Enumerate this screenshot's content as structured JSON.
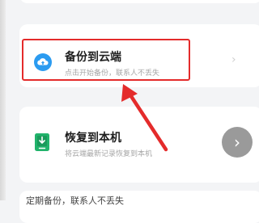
{
  "backup": {
    "title": "备份到云端",
    "subtitle": "点击开始备份，联系人不丢失",
    "icon": "cloud-upload-icon"
  },
  "restore": {
    "title": "恢复到本机",
    "subtitle": "将云端最新记录恢复到本机",
    "icon": "download-to-phone-icon"
  },
  "bottom": {
    "text": "定期备份，联系人不丢失"
  },
  "colors": {
    "accent_blue": "#2b9bf0",
    "accent_green": "#21b36b",
    "annotation_red": "#e42b2b"
  }
}
